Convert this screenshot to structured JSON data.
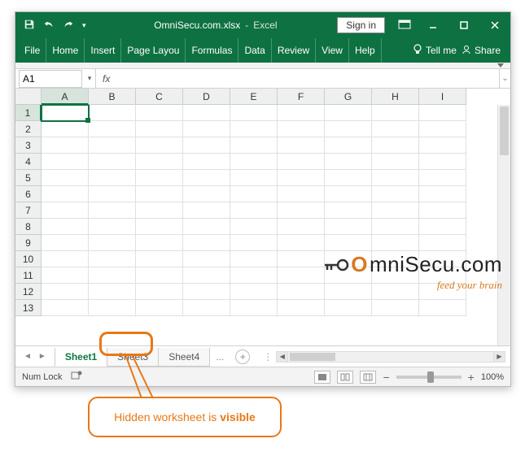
{
  "titlebar": {
    "filename": "OmniSecu.com.xlsx",
    "separator": "-",
    "appname": "Excel",
    "signin": "Sign in"
  },
  "ribbon": {
    "tabs": [
      "File",
      "Home",
      "Insert",
      "Page Layou",
      "Formulas",
      "Data",
      "Review",
      "View",
      "Help"
    ],
    "tellme": "Tell me",
    "share": "Share"
  },
  "namebox": {
    "value": "A1"
  },
  "formula": {
    "fx": "fx"
  },
  "columns": [
    "A",
    "B",
    "C",
    "D",
    "E",
    "F",
    "G",
    "H",
    "I"
  ],
  "rows": [
    "1",
    "2",
    "3",
    "4",
    "5",
    "6",
    "7",
    "8",
    "9",
    "10",
    "11",
    "12",
    "13"
  ],
  "active_cell": {
    "row": 0,
    "col": 0
  },
  "sheets": {
    "tabs": [
      {
        "name": "Sheet1",
        "active": true
      },
      {
        "name": "Sheet3",
        "active": false
      },
      {
        "name": "Sheet4",
        "active": false
      }
    ],
    "more": "..."
  },
  "statusbar": {
    "numlock": "Num Lock",
    "zoom_minus": "−",
    "zoom_plus": "+",
    "zoom": "100%"
  },
  "watermark": {
    "brand_prefix": "O",
    "brand_rest": "mniSecu.com",
    "tagline": "feed your brain"
  },
  "annotation": {
    "text_a": "Hidden worksheet is ",
    "text_b": "visible"
  }
}
